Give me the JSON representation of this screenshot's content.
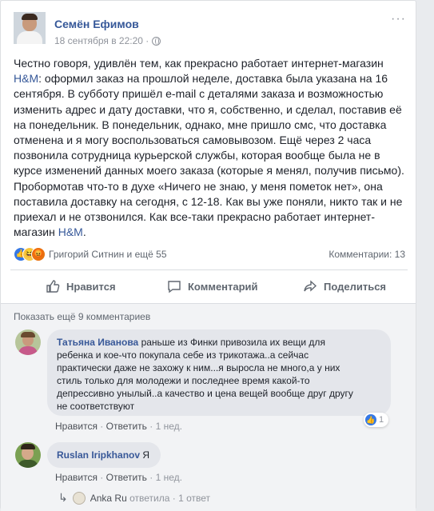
{
  "post": {
    "author": "Семён Ефимов",
    "timestamp": "18 сентября в 22:20 ·",
    "more": "···",
    "text_lines": [
      "Честно говоря, удивлён тем, как прекрасно работает интернет-магазин",
      "H&M: оформил заказ на прошлой неделе, доставка была указана на 16",
      "сентября. В субботу пришёл e-mail с деталями заказа и возможностью",
      "изменить адрес и дату доставки, что я, собственно, и сделал, поставив её",
      "на понедельник. В понедельник, однако, мне пришло смс, что доставка",
      "отменена и я могу воспользоваться самовывозом. Ещё через 2 часа",
      "позвонила сотрудница курьерской службы, которая вообще была не в",
      "курсе изменений данных моего заказа (которые я менял, получив письмо).",
      "Пробормотав что-то в духе «Ничего не знаю, у меня пометок нет», она",
      "поставила доставку на сегодня, с 12-18. Как вы уже поняли, никто так и не",
      "приехал и не отзвонился. Как все-таки прекрасно работает интернет-",
      "магазин H&M."
    ],
    "reactions_text": "Григорий Ситнин и ещё 55",
    "comments_count": "Комментарии: 13"
  },
  "actions": {
    "like": "Нравится",
    "comment": "Комментарий",
    "share": "Поделиться"
  },
  "comments_section": {
    "show_more": "Показать ещё 9 комментариев",
    "comments": [
      {
        "author": "Татьяна Иванова",
        "text_first": "раньше из Финки привозила их вещи для",
        "text_lines": [
          "ребенка и кое-что покупала себе из трикотажа..а сейчас",
          "практически даже не захожу к ним...я выросла не много,а у них",
          "стиль только для молодежи и последнее время какой-то",
          "депрессивно унылый..а качество и цена вещей вообще друг другу",
          "не соответствуют"
        ],
        "like_label": "Нравится",
        "reply_label": "Ответить",
        "age": "1 нед.",
        "likes": "1"
      },
      {
        "author": "Ruslan Iripkhanov",
        "text_first": "Я",
        "like_label": "Нравится",
        "reply_label": "Ответить",
        "age": "1 нед."
      }
    ],
    "reply_summary": {
      "name": "Anka Ru",
      "verb": "ответила",
      "sep": " · ",
      "count": "1 ответ"
    }
  }
}
